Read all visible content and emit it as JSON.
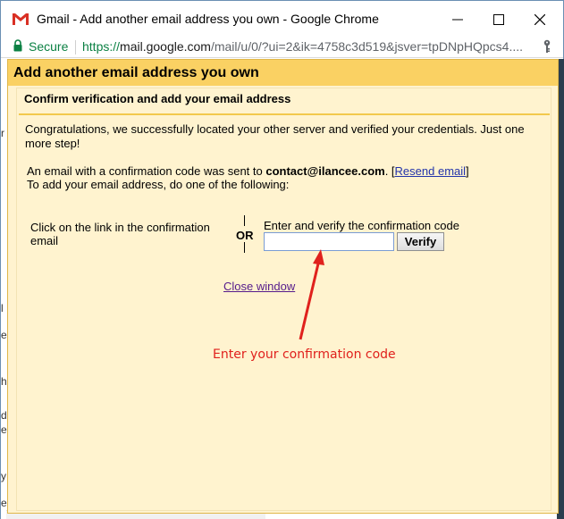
{
  "browser": {
    "window_title": "Gmail - Add another email address you own - Google Chrome",
    "secure_label": "Secure",
    "url_scheme": "https://",
    "url_host": "mail.google.com",
    "url_path": "/mail/u/0/?ui=2&ik=4758c3d519&jsver=tpDNpHQpcs4....",
    "controls": {
      "minimize": "minimize-icon",
      "maximize": "maximize-icon",
      "close": "close-icon"
    }
  },
  "dialog": {
    "title": "Add another email address you own",
    "section_title": "Confirm verification and add your email address",
    "congrats": "Congratulations, we successfully located your other server and verified your credentials. Just one more step!",
    "info_prefix": "An email with a confirmation code was sent to ",
    "email": "contact@ilancee.com",
    "info_mid": ". [",
    "resend_label": "Resend email",
    "info_suffix": "]",
    "instruction": "To add your email address, do one of the following:",
    "link_option": "Click on the link in the confirmation email",
    "or_label": "OR",
    "code_label": "Enter and verify the confirmation code",
    "code_value": "",
    "verify_label": "Verify",
    "close_label": "Close window"
  },
  "annotation": {
    "text": "Enter your confirmation code",
    "color": "#e0211d"
  },
  "colors": {
    "header_bg": "#fad163",
    "dialog_bg": "#fff3cf",
    "secure_green": "#0b8043"
  },
  "background_fragments": [
    "r",
    "l",
    "e",
    "h",
    "d",
    "e",
    "y",
    "e"
  ]
}
